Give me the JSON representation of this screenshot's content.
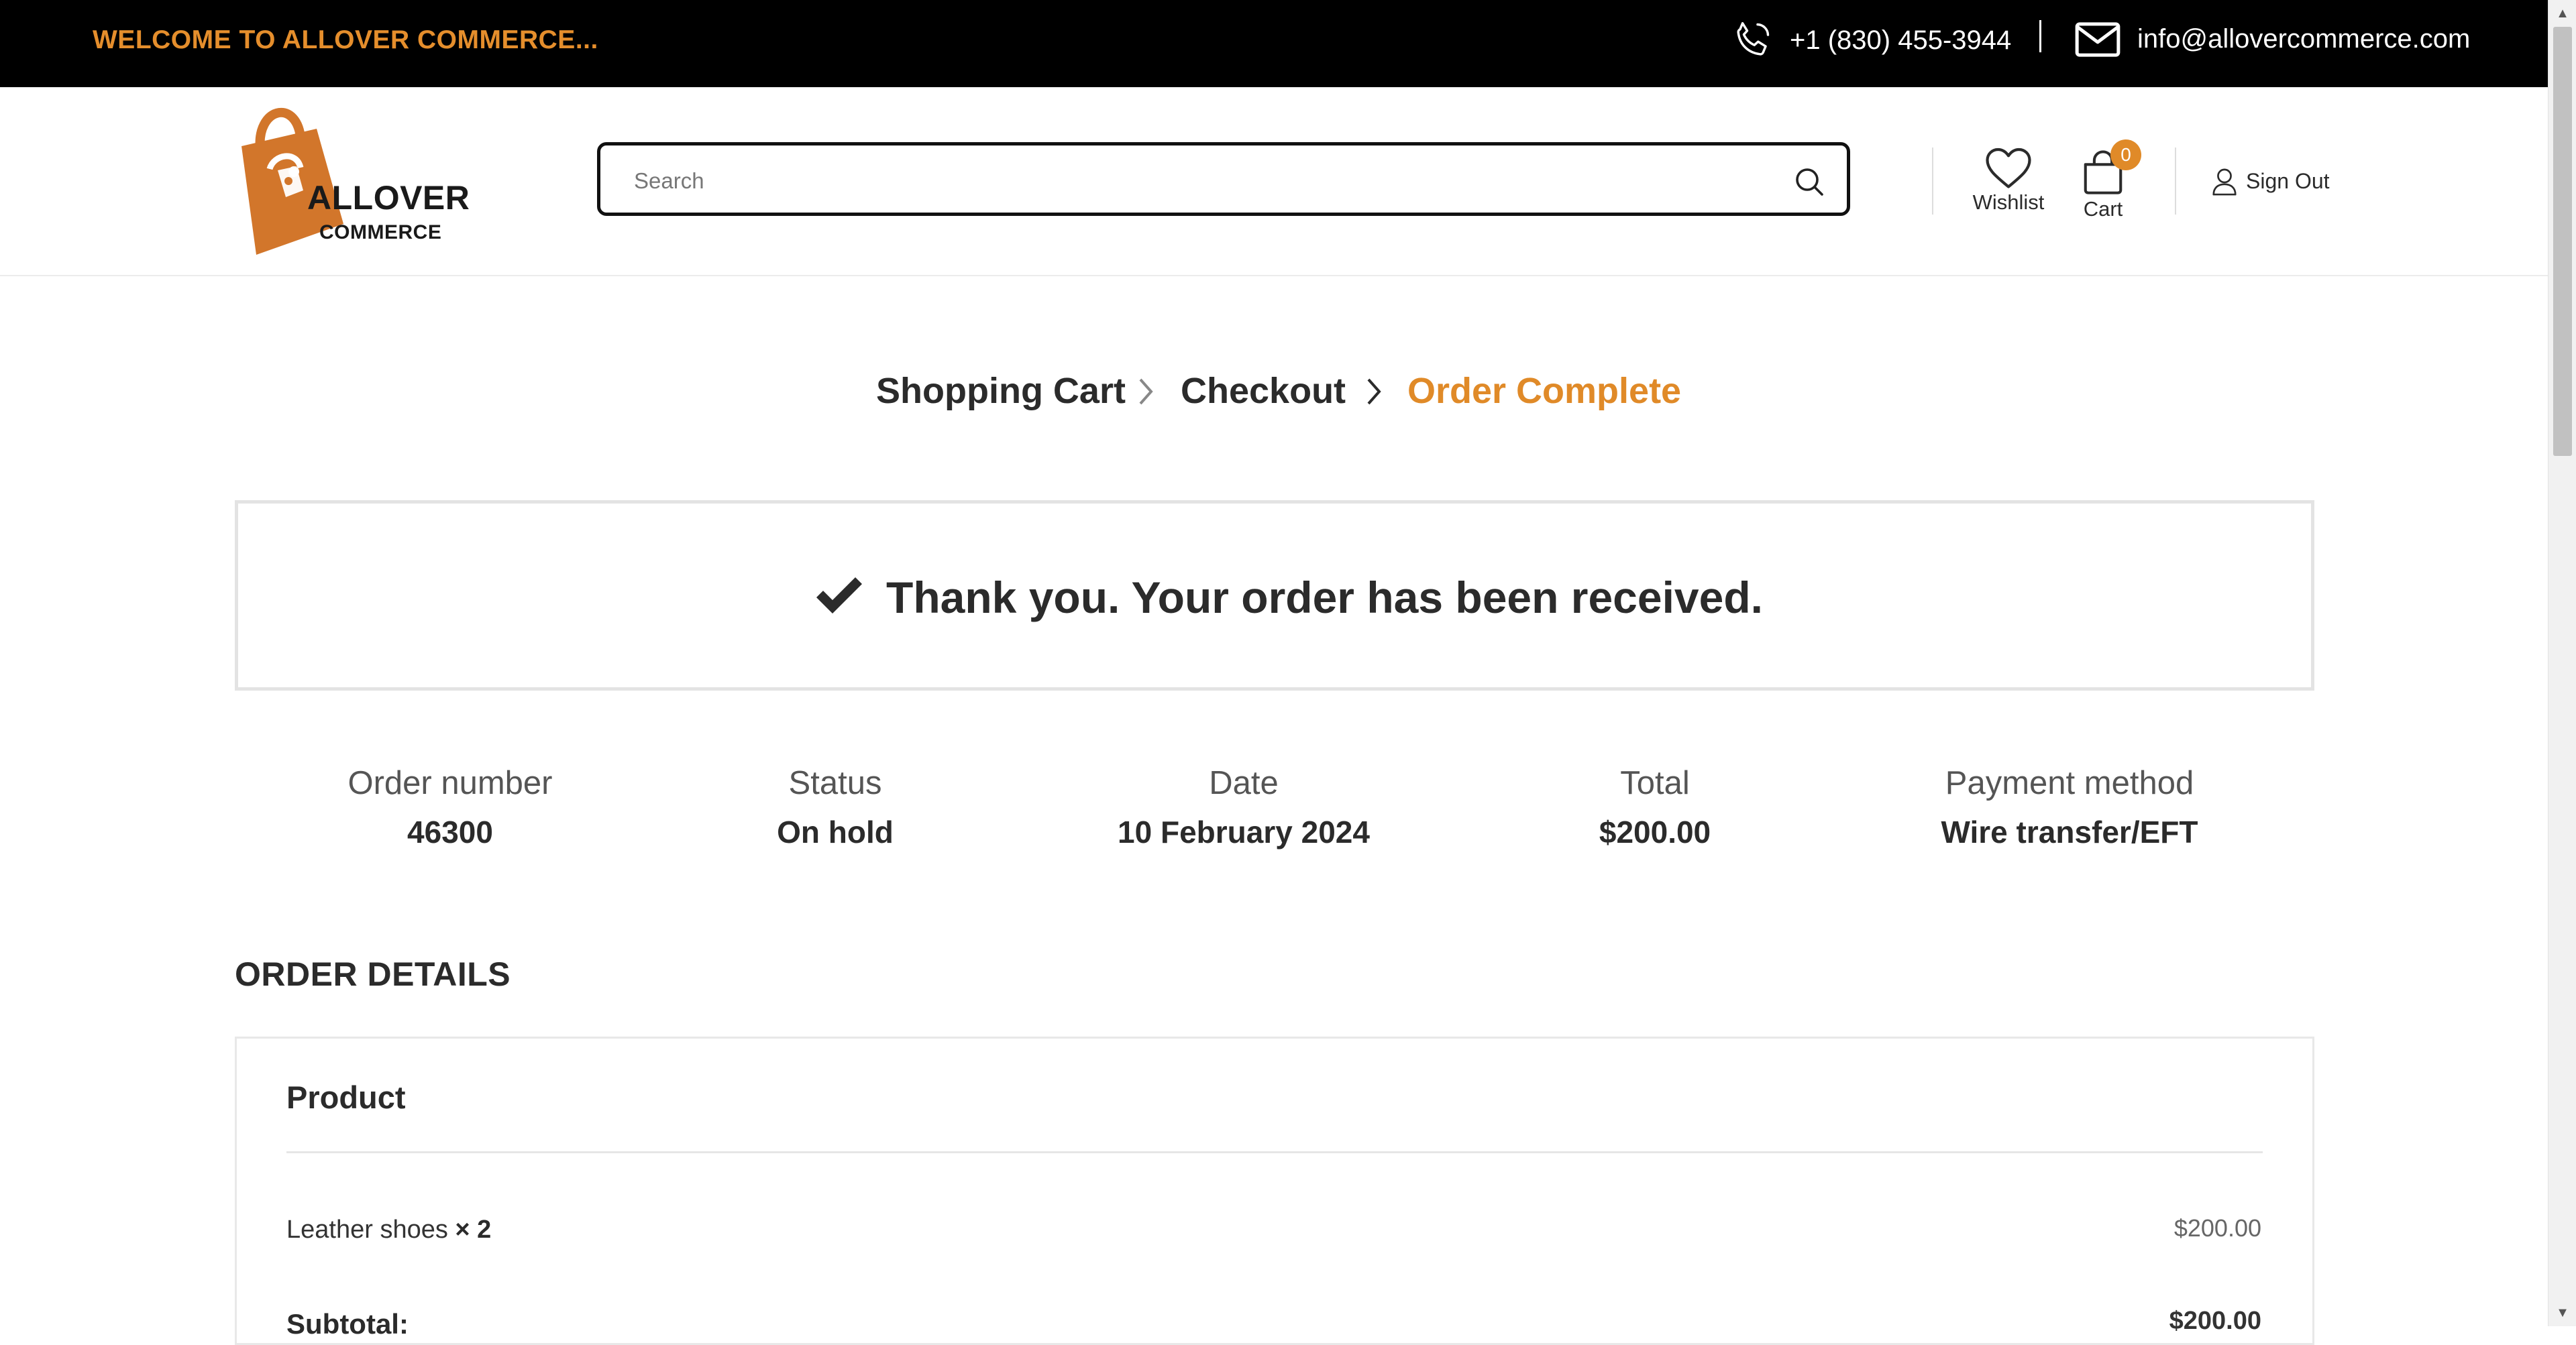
{
  "topbar": {
    "welcome": "WELCOME TO ALLOVER COMMERCE...",
    "phone": "+1 (830) 455-3944",
    "email": "info@allovercommerce.com",
    "accent_color": "#e58e2c"
  },
  "header": {
    "logo": {
      "line1": "ALLOVER",
      "line2": "COMMERCE"
    },
    "search": {
      "placeholder": "Search",
      "icon": "search-icon"
    },
    "wishlist": {
      "label": "Wishlist",
      "icon": "heart-icon"
    },
    "cart": {
      "label": "Cart",
      "count": "0",
      "icon": "shopping-bag-icon"
    },
    "signout": {
      "label": "Sign Out",
      "icon": "user-icon"
    }
  },
  "breadcrumb": {
    "steps": [
      "Shopping Cart",
      "Checkout",
      "Order Complete"
    ],
    "active_index": 2,
    "active_color": "#e08a28"
  },
  "confirmation": {
    "message": "Thank you. Your order has been received.",
    "icon": "checkmark-icon"
  },
  "overview": [
    {
      "label": "Order number",
      "value": "46300"
    },
    {
      "label": "Status",
      "value": "On hold"
    },
    {
      "label": "Date",
      "value": "10 February 2024"
    },
    {
      "label": "Total",
      "value": "$200.00"
    },
    {
      "label": "Payment method",
      "value": "Wire transfer/EFT"
    }
  ],
  "order_details": {
    "title": "ORDER DETAILS",
    "column_product": "Product",
    "items": [
      {
        "name": "Leather shoes",
        "qty": "× 2",
        "price": "$200.00"
      }
    ],
    "subtotal_label": "Subtotal:",
    "subtotal_value": "$200.00"
  }
}
